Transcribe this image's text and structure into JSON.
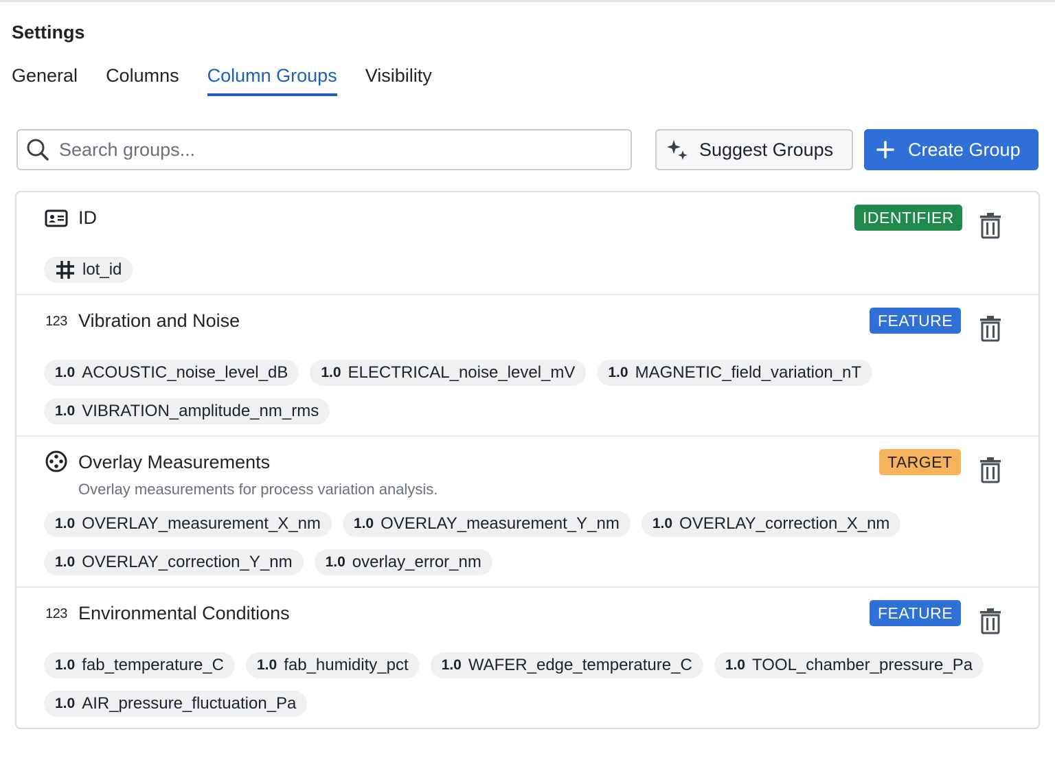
{
  "page": {
    "title": "Settings"
  },
  "tabs": [
    {
      "label": "General",
      "active": false
    },
    {
      "label": "Columns",
      "active": false
    },
    {
      "label": "Column Groups",
      "active": true
    },
    {
      "label": "Visibility",
      "active": false
    }
  ],
  "search": {
    "placeholder": "Search groups...",
    "value": "",
    "icon": "search-icon"
  },
  "actions": {
    "suggest_label": "Suggest Groups",
    "suggest_icon": "sparkles-icon",
    "create_label": "Create Group",
    "create_icon": "plus-icon"
  },
  "colors": {
    "accent": "#2f6fd8",
    "tab_active": "#1f5fb8",
    "identifier": "#1f8a4c",
    "feature": "#2f6fd8",
    "target": "#f7b25c",
    "chip_bg": "#eef0f2"
  },
  "groups": [
    {
      "name": "ID",
      "icon": "id-card-icon",
      "role": "IDENTIFIER",
      "description": "",
      "columns": [
        {
          "type": "#",
          "type_icon": "hash-icon",
          "name": "lot_id"
        }
      ]
    },
    {
      "name": "Vibration and Noise",
      "icon": "123",
      "role": "FEATURE",
      "description": "",
      "columns": [
        {
          "type": "1.0",
          "name": "ACOUSTIC_noise_level_dB"
        },
        {
          "type": "1.0",
          "name": "ELECTRICAL_noise_level_mV"
        },
        {
          "type": "1.0",
          "name": "MAGNETIC_field_variation_nT"
        },
        {
          "type": "1.0",
          "name": "VIBRATION_amplitude_nm_rms"
        }
      ]
    },
    {
      "name": "Overlay Measurements",
      "icon": "target-icon",
      "role": "TARGET",
      "description": "Overlay measurements for process variation analysis.",
      "columns": [
        {
          "type": "1.0",
          "name": "OVERLAY_measurement_X_nm"
        },
        {
          "type": "1.0",
          "name": "OVERLAY_measurement_Y_nm"
        },
        {
          "type": "1.0",
          "name": "OVERLAY_correction_X_nm"
        },
        {
          "type": "1.0",
          "name": "OVERLAY_correction_Y_nm"
        },
        {
          "type": "1.0",
          "name": "overlay_error_nm"
        }
      ]
    },
    {
      "name": "Environmental Conditions",
      "icon": "123",
      "role": "FEATURE",
      "description": "",
      "columns": [
        {
          "type": "1.0",
          "name": "fab_temperature_C"
        },
        {
          "type": "1.0",
          "name": "fab_humidity_pct"
        },
        {
          "type": "1.0",
          "name": "WAFER_edge_temperature_C"
        },
        {
          "type": "1.0",
          "name": "TOOL_chamber_pressure_Pa"
        },
        {
          "type": "1.0",
          "name": "AIR_pressure_fluctuation_Pa"
        }
      ]
    }
  ]
}
